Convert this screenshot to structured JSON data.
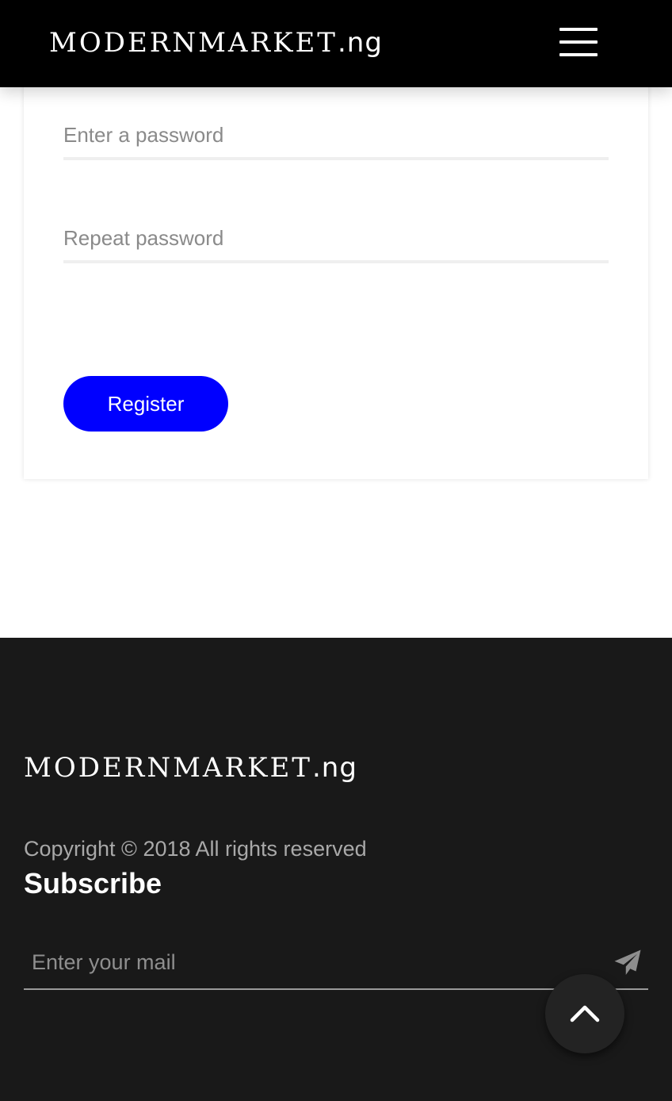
{
  "header": {
    "brand_main": "MODERNMARKET",
    "brand_suffix": ".ng",
    "menu_icon": "hamburger-menu-icon"
  },
  "form": {
    "password_placeholder": "Enter a password",
    "repeat_password_placeholder": "Repeat password",
    "register_label": "Register"
  },
  "footer": {
    "brand_main": "MODERNMARKET",
    "brand_suffix": ".ng",
    "copyright": "Copyright © 2018 All rights reserved",
    "subscribe_title": "Subscribe",
    "mail_placeholder": "Enter your mail",
    "send_icon": "paper-plane-icon",
    "scroll_top_icon": "chevron-up-icon"
  },
  "colors": {
    "header_bg": "#000000",
    "register_button": "#0000ff",
    "footer_bg": "#191919"
  }
}
